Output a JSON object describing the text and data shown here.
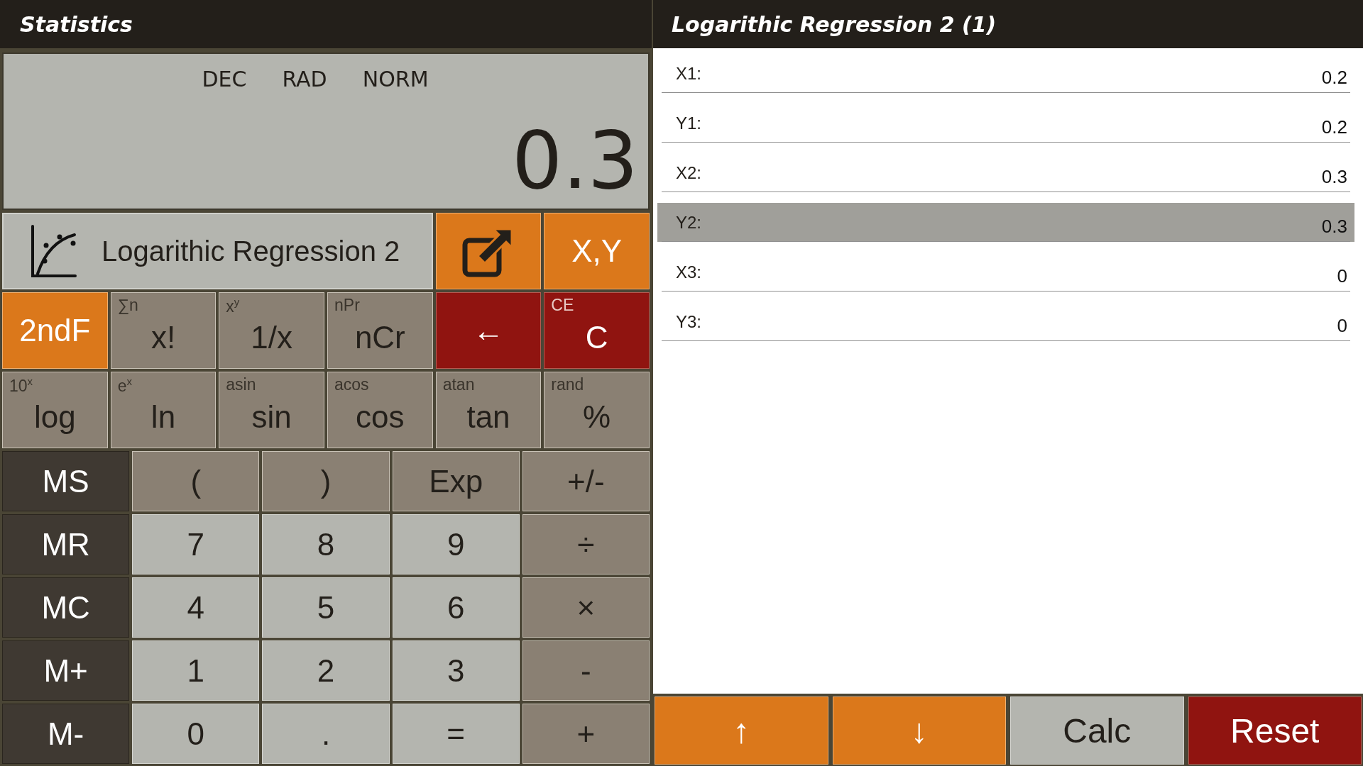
{
  "calculator": {
    "title": "Statistics",
    "display": {
      "modes": [
        "DEC",
        "RAD",
        "NORM"
      ],
      "value": "0.3"
    },
    "mode_row": {
      "label": "Logarithic Regression 2",
      "xy_button": "X,Y"
    },
    "function_keys": [
      {
        "label": "2ndF",
        "kind": "accent"
      },
      {
        "label": "x!",
        "sub": "∑n",
        "kind": "function"
      },
      {
        "label": "1/x",
        "sub": "x$^{y}$",
        "kind": "function"
      },
      {
        "label": "nCr",
        "sub": "nPr",
        "kind": "function"
      },
      {
        "label": "←",
        "kind": "danger"
      },
      {
        "label": "C",
        "sub": "CE",
        "kind": "danger"
      },
      {
        "label": "log",
        "sub": "10$^{x}$",
        "kind": "function"
      },
      {
        "label": "ln",
        "sub": "e$^{x}$",
        "kind": "function"
      },
      {
        "label": "sin",
        "sub": "asin",
        "kind": "function"
      },
      {
        "label": "cos",
        "sub": "acos",
        "kind": "function"
      },
      {
        "label": "tan",
        "sub": "atan",
        "kind": "function"
      },
      {
        "label": "%",
        "sub": "rand",
        "kind": "function"
      }
    ],
    "keys": [
      {
        "label": "MS",
        "kind": "memory"
      },
      {
        "label": "(",
        "kind": "function"
      },
      {
        "label": ")",
        "kind": "function"
      },
      {
        "label": "Exp",
        "kind": "function"
      },
      {
        "label": "+/-",
        "kind": "function"
      },
      {
        "label": "MR",
        "kind": "memory"
      },
      {
        "label": "7",
        "kind": "digit"
      },
      {
        "label": "8",
        "kind": "digit"
      },
      {
        "label": "9",
        "kind": "digit"
      },
      {
        "label": "÷",
        "kind": "function"
      },
      {
        "label": "MC",
        "kind": "memory"
      },
      {
        "label": "4",
        "kind": "digit"
      },
      {
        "label": "5",
        "kind": "digit"
      },
      {
        "label": "6",
        "kind": "digit"
      },
      {
        "label": "×",
        "kind": "function"
      },
      {
        "label": "M+",
        "kind": "memory"
      },
      {
        "label": "1",
        "kind": "digit"
      },
      {
        "label": "2",
        "kind": "digit"
      },
      {
        "label": "3",
        "kind": "digit"
      },
      {
        "label": "-",
        "kind": "function"
      },
      {
        "label": "M-",
        "kind": "memory"
      },
      {
        "label": "0",
        "kind": "digit"
      },
      {
        "label": ".",
        "kind": "digit"
      },
      {
        "label": "=",
        "kind": "digit"
      },
      {
        "label": "+",
        "kind": "function"
      }
    ]
  },
  "data_panel": {
    "title": "Logarithic Regression 2 (1)",
    "rows": [
      {
        "label": "X1:",
        "value": "0.2",
        "selected": false
      },
      {
        "label": "Y1:",
        "value": "0.2",
        "selected": false
      },
      {
        "label": "X2:",
        "value": "0.3",
        "selected": false
      },
      {
        "label": "Y2:",
        "value": "0.3",
        "selected": true
      },
      {
        "label": "X3:",
        "value": "0",
        "selected": false
      },
      {
        "label": "Y3:",
        "value": "0",
        "selected": false
      }
    ],
    "buttons": [
      {
        "label": "↑",
        "kind": "accent"
      },
      {
        "label": "↓",
        "kind": "accent"
      },
      {
        "label": "Calc",
        "kind": "plain"
      },
      {
        "label": "Reset",
        "kind": "danger"
      }
    ]
  }
}
